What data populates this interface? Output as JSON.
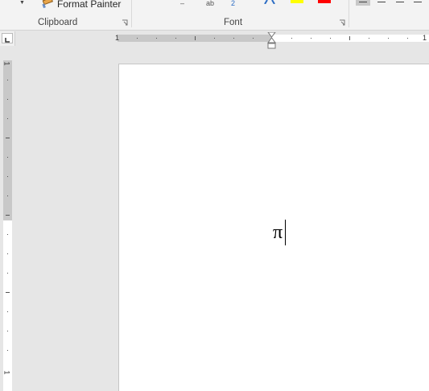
{
  "ribbon": {
    "clipboard": {
      "label": "Clipboard",
      "format_painter_label": "Format Painter"
    },
    "font": {
      "label": "Font",
      "highlight_color": "#ffff00",
      "font_color": "#ff0000",
      "subscript_mark": "2"
    }
  },
  "rulers": {
    "horizontal_numbers": [
      "1",
      "1"
    ],
    "vertical_numbers": [
      "1",
      "1"
    ]
  },
  "document": {
    "text": "π"
  }
}
